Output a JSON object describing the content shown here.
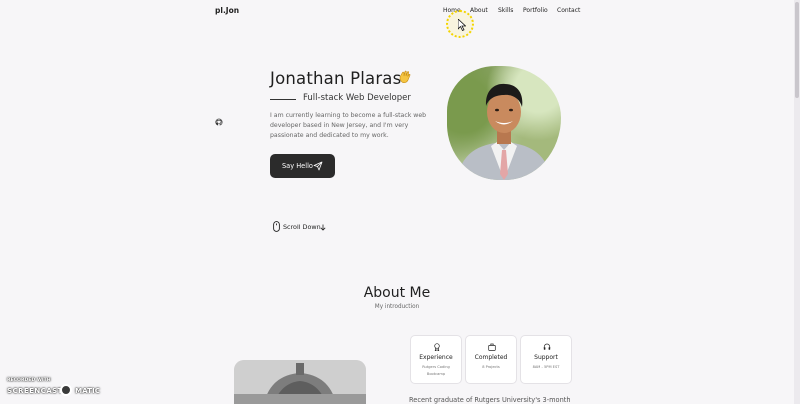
{
  "header": {
    "logo": "pl.Jon",
    "nav": [
      "Home",
      "About",
      "Skills",
      "Portfolio",
      "Contact"
    ]
  },
  "hero": {
    "name": "Jonathan Plaras",
    "subtitle": "Full-stack Web Developer",
    "description": "I am currently learning to become a full-stack web developer based in New Jersey, and I'm very passionate and dedicated to my work.",
    "cta_label": "Say Hello",
    "scroll_label": "Scroll Down"
  },
  "about": {
    "title": "About Me",
    "subtitle": "My introduction",
    "cards": [
      {
        "title": "Experience",
        "sub": "Rutgers Coding Bootcamp",
        "icon": "award-icon"
      },
      {
        "title": "Completed",
        "sub": "8 Projects",
        "icon": "briefcase-icon"
      },
      {
        "title": "Support",
        "sub": "8AM - 5PM EST",
        "icon": "headset-icon"
      }
    ],
    "text": "Recent graduate of Rutgers University's 3-month"
  },
  "watermark": {
    "small": "RECORDED WITH",
    "big": "SCREENCAST",
    "suffix": "MATIC"
  },
  "colors": {
    "background": "#f7f6f8",
    "button": "#2b2b2b",
    "accent_halo": "#f3d400"
  }
}
